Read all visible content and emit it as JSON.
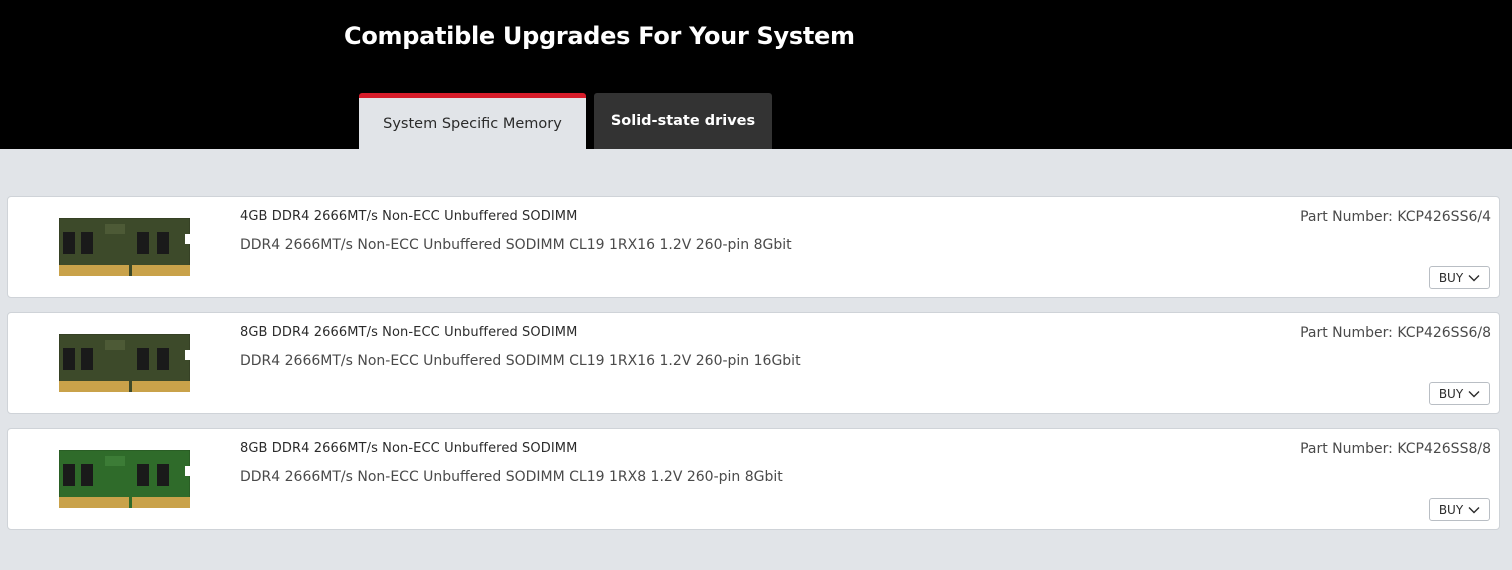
{
  "header": {
    "title": "Compatible Upgrades For Your System"
  },
  "tabs": [
    {
      "label": "System Specific Memory",
      "active": true
    },
    {
      "label": "Solid-state drives",
      "active": false
    }
  ],
  "colors": {
    "accent": "#d71c2a",
    "header_bg": "#000000",
    "content_bg": "#e1e4e8",
    "inactive_tab_bg": "#333333"
  },
  "products": [
    {
      "name": "4GB DDR4 2666MT/s Non-ECC Unbuffered SODIMM",
      "description": "DDR4 2666MT/s Non-ECC Unbuffered SODIMM CL19 1RX16 1.2V 260-pin 8Gbit",
      "part_number": "Part Number: KCP426SS6/4",
      "buy_label": "BUY",
      "image": "sodimm-memory-module-icon"
    },
    {
      "name": "8GB DDR4 2666MT/s Non-ECC Unbuffered SODIMM",
      "description": "DDR4 2666MT/s Non-ECC Unbuffered SODIMM CL19 1RX16 1.2V 260-pin 16Gbit",
      "part_number": "Part Number: KCP426SS6/8",
      "buy_label": "BUY",
      "image": "sodimm-memory-module-icon"
    },
    {
      "name": "8GB DDR4 2666MT/s Non-ECC Unbuffered SODIMM",
      "description": "DDR4 2666MT/s Non-ECC Unbuffered SODIMM CL19 1RX8 1.2V 260-pin 8Gbit",
      "part_number": "Part Number: KCP426SS8/8",
      "buy_label": "BUY",
      "image": "sodimm-memory-module-icon"
    }
  ]
}
